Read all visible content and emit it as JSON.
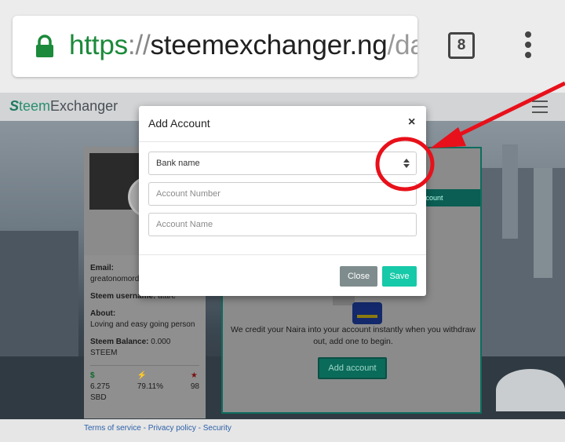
{
  "browser": {
    "url_scheme": "https",
    "url_separator": "://",
    "url_domain": "steemexchanger.ng",
    "url_rest": "/da",
    "tab_count": "8"
  },
  "site": {
    "logo_s": "S",
    "logo_teem": "teem",
    "logo_exchanger": "Exchanger"
  },
  "profile": {
    "email_label": "Email:",
    "email_value": "greatonomord",
    "username_label": "Steem username:",
    "username_value": "atare",
    "about_label": "About:",
    "about_value": "Loving and easy going person",
    "balance_label": "Steem Balance:",
    "balance_value": "0.000 STEEM",
    "stats": [
      {
        "icon": "$",
        "value": "6.275",
        "unit": "SBD"
      },
      {
        "icon": "⚡",
        "value": "79.11%"
      },
      {
        "icon": "★",
        "value": "98"
      }
    ]
  },
  "account_panel": {
    "tab_label": "ccount",
    "description": "We credit your Naira into your account instantly when you withdraw out, add one to begin.",
    "add_button": "Add account"
  },
  "footer": {
    "terms": "Terms of service",
    "dash1": " - ",
    "privacy": "Privacy policy",
    "dash2": " - ",
    "security": "Security"
  },
  "modal": {
    "title": "Add Account",
    "close_x": "×",
    "bank_select": "Bank name",
    "account_number_placeholder": "Account Number",
    "account_name_placeholder": "Account Name",
    "close_button": "Close",
    "save_button": "Save"
  },
  "annotation": {
    "color": "#e8101a"
  }
}
